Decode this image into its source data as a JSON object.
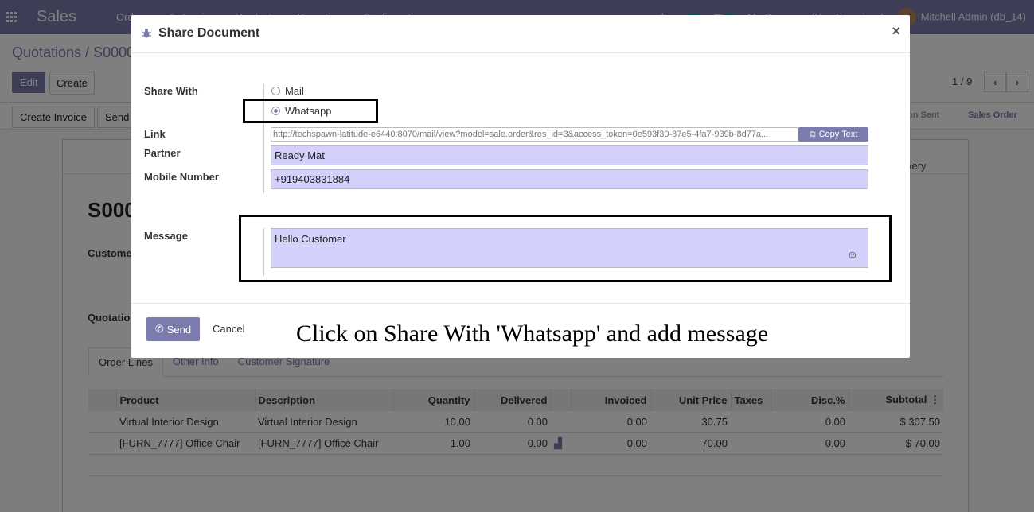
{
  "navbar": {
    "app_name": "Sales",
    "menu": [
      "Orders",
      "To Invoice",
      "Products",
      "Reporting",
      "Configuration"
    ],
    "activity_count": "21",
    "message_count": "8",
    "company": "My Company (San Francisco)",
    "user": "Mitchell Admin (db_14)"
  },
  "control_panel": {
    "breadcrumb": "Quotations / S0000",
    "edit_label": "Edit",
    "create_label": "Create",
    "pager": "1 / 9"
  },
  "statusbar": {
    "create_invoice_label": "Create Invoice",
    "send_label": "Send",
    "stage_sent": "on Sent",
    "stage_sales_order": "Sales Order"
  },
  "sheet": {
    "smart_button": "very",
    "title": "S000",
    "customer_label": "Custome",
    "quotation_label": "Quotatio",
    "tabs": [
      "Order Lines",
      "Other Info",
      "Customer Signature"
    ],
    "columns": [
      "Product",
      "Description",
      "Quantity",
      "Delivered",
      "",
      "Invoiced",
      "Unit Price",
      "Taxes",
      "Disc.%",
      "Subtotal"
    ],
    "rows": [
      [
        "Virtual Interior Design",
        "Virtual Interior Design",
        "10.00",
        "0.00",
        "",
        "0.00",
        "30.75",
        "",
        "0.00",
        "$ 307.50"
      ],
      [
        "[FURN_7777] Office Chair",
        "[FURN_7777] Office Chair",
        "1.00",
        "0.00",
        "chart",
        "0.00",
        "70.00",
        "",
        "0.00",
        "$ 70.00"
      ]
    ]
  },
  "modal": {
    "title": "Share Document",
    "share_with_label": "Share With",
    "option_mail": "Mail",
    "option_whatsapp": "Whatsapp",
    "selected_option": "Whatsapp",
    "link_label": "Link",
    "link_value": "http://techspawn-latitude-e6440:8070/mail/view?model=sale.order&res_id=3&access_token=0e593f30-87e5-4fa7-939b-8d77a...",
    "copy_label": "Copy Text",
    "partner_label": "Partner",
    "partner_value": "Ready Mat",
    "mobile_label": "Mobile Number",
    "mobile_value": "+919403831884",
    "message_label": "Message",
    "message_value": "Hello Customer",
    "send_label": "Send",
    "cancel_label": "Cancel"
  },
  "annotation": {
    "caption": "Click on Share With 'Whatsapp' and add message"
  },
  "colors": {
    "primary": "#7c7bad",
    "field_bg": "#d3d1fb",
    "badge": "#00a09d"
  }
}
